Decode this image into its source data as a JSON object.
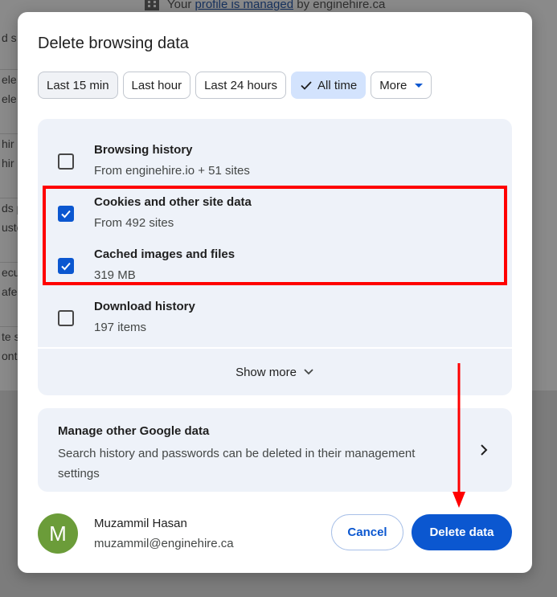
{
  "background": {
    "managed_prefix": "Your ",
    "managed_link": "profile is managed",
    "managed_suffix": " by enginehire.ca",
    "row_fragments": [
      [
        "d s"
      ],
      [
        "ele",
        "ele"
      ],
      [
        "hir",
        "hir"
      ],
      [
        "ds p",
        "usto"
      ],
      [
        "ecu",
        "afe"
      ],
      [
        "te s",
        "ont"
      ]
    ]
  },
  "dialog": {
    "title": "Delete browsing data",
    "time_ranges": [
      {
        "label": "Last 15 min"
      },
      {
        "label": "Last hour"
      },
      {
        "label": "Last 24 hours"
      },
      {
        "label": "All time",
        "selected": true
      },
      {
        "label": "More"
      }
    ],
    "data_types": [
      {
        "label": "Browsing history",
        "sub": "From enginehire.io + 51 sites",
        "checked": false
      },
      {
        "label": "Cookies and other site data",
        "sub": "From 492 sites",
        "checked": true
      },
      {
        "label": "Cached images and files",
        "sub": "319 MB",
        "checked": true
      },
      {
        "label": "Download history",
        "sub": "197 items",
        "checked": false
      }
    ],
    "show_more": "Show more",
    "manage": {
      "title": "Manage other Google data",
      "desc": "Search history and passwords can be deleted in their management settings"
    },
    "account": {
      "initial": "M",
      "name": "Muzammil Hasan",
      "email": "muzammil@enginehire.ca",
      "avatar_color": "#6b9c39"
    },
    "buttons": {
      "cancel": "Cancel",
      "delete": "Delete data"
    }
  },
  "colors": {
    "accent": "#0b57d0",
    "selected_chip": "#d3e3fd",
    "annotation": "#ff0000"
  }
}
